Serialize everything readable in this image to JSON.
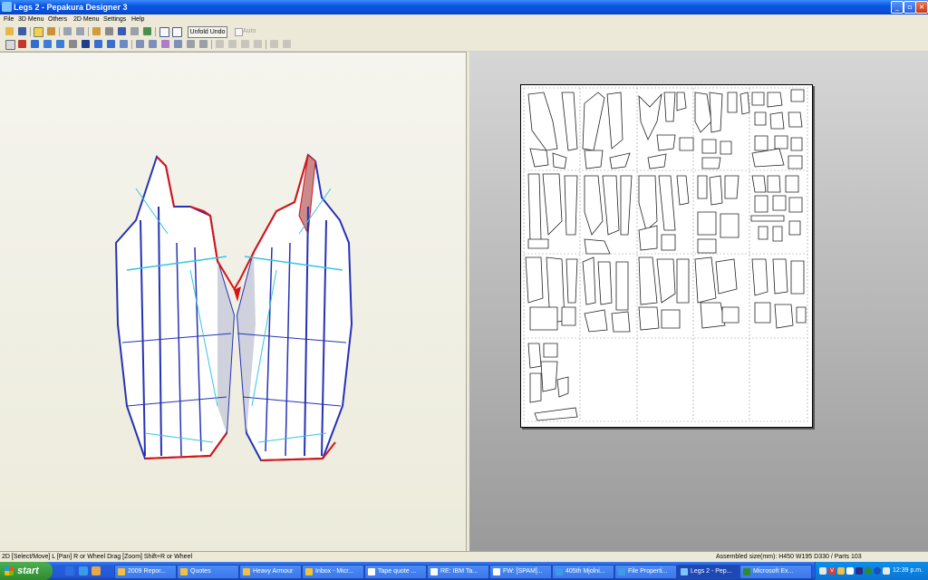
{
  "window": {
    "title": "Legs 2 - Pepakura Designer 3",
    "min_glyph": "_",
    "max_glyph": "▫",
    "close_glyph": "×"
  },
  "menu": [
    "File",
    "3D Menu",
    "Others",
    "2D Menu",
    "Settings",
    "Help"
  ],
  "toolbar": {
    "unfold_undo": "Unfold Undo",
    "auto": "Auto"
  },
  "status": {
    "left": "2D [Select/Move] L [Pan] R or Wheel Drag [Zoom] Shift+R or Wheel",
    "right": "Assembled size(mm): H450 W195 D330 / Parts 103"
  },
  "taskbar": {
    "start": "start",
    "buttons": [
      "2009 Repor...",
      "Quotes",
      "Heavy Armour",
      "Inbox - Micr...",
      "Tape quote ...",
      "RE: IBM Ta...",
      "FW: [SPAM]...",
      "405th Mjolni...",
      "File Properti...",
      "Legs 2 - Pep...",
      "Microsoft Ex..."
    ],
    "active_index": 9,
    "clock": "12:39 p.m.",
    "tray_text": "V"
  },
  "colors": {
    "accent": "#0a54e3",
    "seam_red": "#d81414",
    "fold_blue": "#2632b4",
    "fold_cyan": "#37c6e0"
  }
}
